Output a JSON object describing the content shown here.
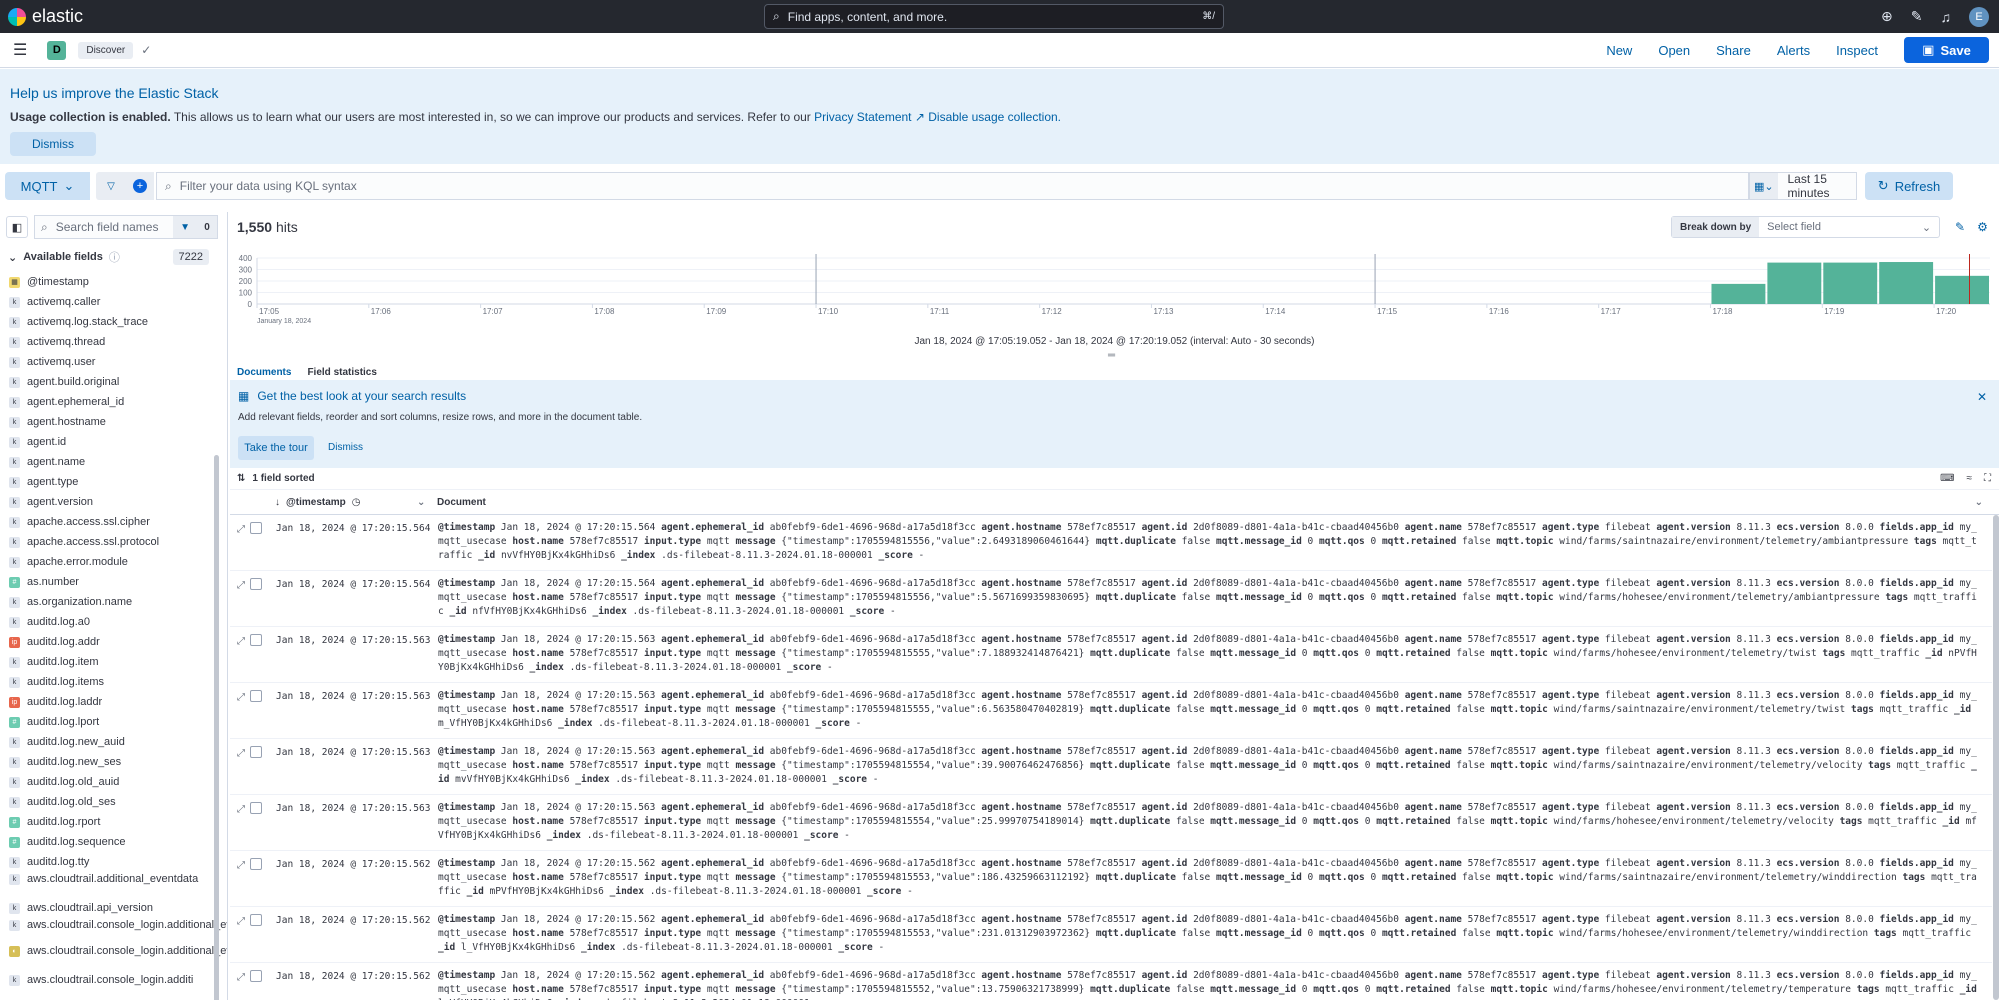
{
  "header": {
    "brand": "elastic",
    "search_placeholder": "Find apps, content, and more.",
    "search_shortcut": "⌘/",
    "avatar": "E"
  },
  "nav": {
    "space": "D",
    "breadcrumb": "Discover",
    "links": [
      "New",
      "Open",
      "Share",
      "Alerts",
      "Inspect"
    ],
    "save": "Save"
  },
  "callout": {
    "title": "Help us improve the Elastic Stack",
    "bold": "Usage collection is enabled.",
    "text": " This allows us to learn what our users are most interested in, so we can improve our products and services. Refer to our ",
    "privacy": "Privacy Statement",
    "disable": "Disable usage collection.",
    "dismiss": "Dismiss"
  },
  "query": {
    "data_view": "MQTT",
    "placeholder": "Filter your data using KQL syntax",
    "time": "Last 15 minutes",
    "refresh": "Refresh"
  },
  "sidebar": {
    "search_placeholder": "Search field names",
    "filter_count": "0",
    "available_label": "Available fields",
    "available_count": "7222",
    "fields": [
      {
        "type": "d",
        "glyph": "▦",
        "name": "@timestamp"
      },
      {
        "type": "k",
        "glyph": "k",
        "name": "activemq.caller"
      },
      {
        "type": "k",
        "glyph": "k",
        "name": "activemq.log.stack_trace"
      },
      {
        "type": "k",
        "glyph": "k",
        "name": "activemq.thread"
      },
      {
        "type": "k",
        "glyph": "k",
        "name": "activemq.user"
      },
      {
        "type": "k",
        "glyph": "k",
        "name": "agent.build.original"
      },
      {
        "type": "k",
        "glyph": "k",
        "name": "agent.ephemeral_id"
      },
      {
        "type": "k",
        "glyph": "k",
        "name": "agent.hostname"
      },
      {
        "type": "k",
        "glyph": "k",
        "name": "agent.id"
      },
      {
        "type": "k",
        "glyph": "k",
        "name": "agent.name"
      },
      {
        "type": "k",
        "glyph": "k",
        "name": "agent.type"
      },
      {
        "type": "k",
        "glyph": "k",
        "name": "agent.version"
      },
      {
        "type": "k",
        "glyph": "k",
        "name": "apache.access.ssl.cipher"
      },
      {
        "type": "k",
        "glyph": "k",
        "name": "apache.access.ssl.protocol"
      },
      {
        "type": "k",
        "glyph": "k",
        "name": "apache.error.module"
      },
      {
        "type": "n",
        "glyph": "#",
        "name": "as.number"
      },
      {
        "type": "k",
        "glyph": "k",
        "name": "as.organization.name"
      },
      {
        "type": "k",
        "glyph": "k",
        "name": "auditd.log.a0"
      },
      {
        "type": "ip",
        "glyph": "ip",
        "name": "auditd.log.addr"
      },
      {
        "type": "k",
        "glyph": "k",
        "name": "auditd.log.item"
      },
      {
        "type": "k",
        "glyph": "k",
        "name": "auditd.log.items"
      },
      {
        "type": "ip",
        "glyph": "ip",
        "name": "auditd.log.laddr"
      },
      {
        "type": "n",
        "glyph": "#",
        "name": "auditd.log.lport"
      },
      {
        "type": "k",
        "glyph": "k",
        "name": "auditd.log.new_auid"
      },
      {
        "type": "k",
        "glyph": "k",
        "name": "auditd.log.new_ses"
      },
      {
        "type": "k",
        "glyph": "k",
        "name": "auditd.log.old_auid"
      },
      {
        "type": "k",
        "glyph": "k",
        "name": "auditd.log.old_ses"
      },
      {
        "type": "n",
        "glyph": "#",
        "name": "auditd.log.rport"
      },
      {
        "type": "n",
        "glyph": "#",
        "name": "auditd.log.sequence"
      },
      {
        "type": "k",
        "glyph": "k",
        "name": "auditd.log.tty"
      },
      {
        "type": "k",
        "glyph": "k",
        "name": "aws.cloudtrail.additional_eventdata",
        "two": true
      },
      {
        "type": "k",
        "glyph": "k",
        "name": "aws.cloudtrail.api_version"
      },
      {
        "type": "k",
        "glyph": "k",
        "name": "aws.cloudtrail.console_login.additional_eventdata.login_to",
        "two": true
      },
      {
        "type": "b",
        "glyph": "◐",
        "name": "aws.cloudtrail.console_login.additional_eventdata.mfa_used",
        "two": true
      },
      {
        "type": "k",
        "glyph": "k",
        "name": "aws.cloudtrail.console_login.additi"
      }
    ]
  },
  "main": {
    "hits_count": "1,550",
    "hits_label": "hits",
    "breakdown_label": "Break down by",
    "breakdown_placeholder": "Select field",
    "interval": "Jan 18, 2024 @ 17:05:19.052 - Jan 18, 2024 @ 17:20:19.052 (interval: Auto - 30 seconds)",
    "tabs": [
      "Documents",
      "Field statistics"
    ],
    "tour_title": "Get the best look at your search results",
    "tour_sub": "Add relevant fields, reorder and sort columns, resize rows, and more in the document table.",
    "tour_button": "Take the tour",
    "tour_dismiss": "Dismiss",
    "sorted": "1 field sorted",
    "col_timestamp": "@timestamp",
    "col_document": "Document"
  },
  "chart_data": {
    "type": "bar",
    "xlabel": "",
    "ylabel": "",
    "ylim": [
      0,
      400
    ],
    "yticks": [
      0,
      100,
      200,
      300,
      400
    ],
    "xticks": [
      "17:05",
      "17:06",
      "17:07",
      "17:08",
      "17:09",
      "17:10",
      "17:11",
      "17:12",
      "17:13",
      "17:14",
      "17:15",
      "17:16",
      "17:17",
      "17:18",
      "17:19",
      "17:20"
    ],
    "xtick_sublabel": "January 18, 2024",
    "x": [
      "17:18:00",
      "17:18:30",
      "17:19:00",
      "17:19:30",
      "17:20:00"
    ],
    "values": [
      175,
      360,
      360,
      365,
      245
    ],
    "bar_color": "#54b399"
  },
  "rows": [
    {
      "ts": "Jan 18, 2024 @ 17:20:15.564",
      "ts_doc": "Jan 18, 2024 @ 17:20:15.564",
      "value": "{\"timestamp\":1705594815556,\"value\":2.6493189060461644}",
      "topic": "wind/farms/saintnazaire/environment/telemetry/ambiantpressure",
      "id": "nvVfHY0BjKx4kGHhiDs6"
    },
    {
      "ts": "Jan 18, 2024 @ 17:20:15.564",
      "ts_doc": "Jan 18, 2024 @ 17:20:15.564",
      "value": "{\"timestamp\":1705594815556,\"value\":5.5671699359830695}",
      "topic": "wind/farms/hohesee/environment/telemetry/ambiantpressure",
      "id": "nfVfHY0BjKx4kGHhiDs6"
    },
    {
      "ts": "Jan 18, 2024 @ 17:20:15.563",
      "ts_doc": "Jan 18, 2024 @ 17:20:15.563",
      "value": "{\"timestamp\":1705594815555,\"value\":7.188932414876421}",
      "topic": "wind/farms/hohesee/environment/telemetry/twist",
      "id": "nPVfHY0BjKx4kGHhiDs6"
    },
    {
      "ts": "Jan 18, 2024 @ 17:20:15.563",
      "ts_doc": "Jan 18, 2024 @ 17:20:15.563",
      "value": "{\"timestamp\":1705594815555,\"value\":6.563580470402819}",
      "topic": "wind/farms/saintnazaire/environment/telemetry/twist",
      "id": "m_VfHY0BjKx4kGHhiDs6"
    },
    {
      "ts": "Jan 18, 2024 @ 17:20:15.563",
      "ts_doc": "Jan 18, 2024 @ 17:20:15.563",
      "value": "{\"timestamp\":1705594815554,\"value\":39.90076462476856}",
      "topic": "wind/farms/saintnazaire/environment/telemetry/velocity",
      "id": "mvVfHY0BjKx4kGHhiDs6"
    },
    {
      "ts": "Jan 18, 2024 @ 17:20:15.563",
      "ts_doc": "Jan 18, 2024 @ 17:20:15.563",
      "value": "{\"timestamp\":1705594815554,\"value\":25.99970754189014}",
      "topic": "wind/farms/hohesee/environment/telemetry/velocity",
      "id": "mfVfHY0BjKx4kGHhiDs6"
    },
    {
      "ts": "Jan 18, 2024 @ 17:20:15.562",
      "ts_doc": "Jan 18, 2024 @ 17:20:15.562",
      "value": "{\"timestamp\":1705594815553,\"value\":186.43259663112192}",
      "topic": "wind/farms/saintnazaire/environment/telemetry/winddirection",
      "id": "mPVfHY0BjKx4kGHhiDs6"
    },
    {
      "ts": "Jan 18, 2024 @ 17:20:15.562",
      "ts_doc": "Jan 18, 2024 @ 17:20:15.562",
      "value": "{\"timestamp\":1705594815553,\"value\":231.01312903972362}",
      "topic": "wind/farms/hohesee/environment/telemetry/winddirection",
      "id": "l_VfHY0BjKx4kGHhiDs6"
    },
    {
      "ts": "Jan 18, 2024 @ 17:20:15.562",
      "ts_doc": "Jan 18, 2024 @ 17:20:15.562",
      "value": "{\"timestamp\":1705594815552,\"value\":13.75906321738999}",
      "topic": "wind/farms/hohesee/environment/telemetry/temperature",
      "id": "lvVfHY0BjKx4kGHhiDs6"
    }
  ],
  "row_common": {
    "ephemeral_id": "ab0febf9-6de1-4696-968d-a17a5d18f3cc",
    "hostname": "578ef7c85517",
    "agent_id": "2d0f8089-d801-4a1a-b41c-cbaad40456b0",
    "agent_name": "578ef7c85517",
    "agent_type": "filebeat",
    "agent_version": "8.11.3",
    "ecs_version": "8.0.0",
    "app_id": "my_mqtt_usecase",
    "host_name": "578ef7c85517",
    "input_type": "mqtt",
    "duplicate": "false",
    "message_id": "0",
    "qos": "0",
    "retained": "false",
    "tags": "mqtt_traffic",
    "index": ".ds-filebeat-8.11.3-2024.01.18-000001",
    "score": "-"
  }
}
